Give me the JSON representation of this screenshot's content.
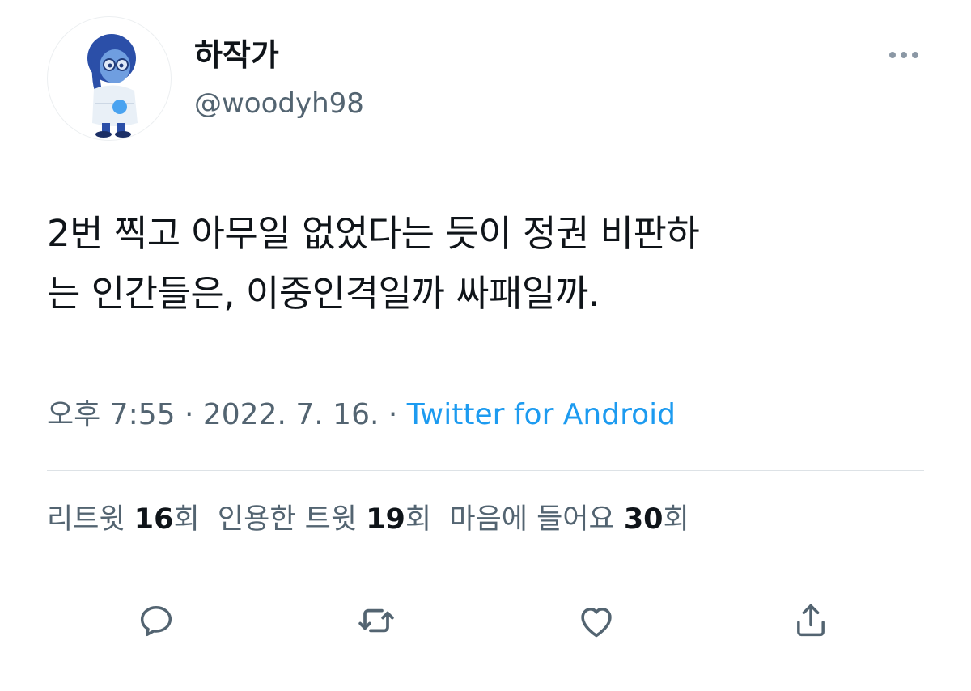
{
  "tweet": {
    "author": {
      "display_name": "하작가",
      "handle": "@woodyh98"
    },
    "text_lines": [
      "2번 찍고 아무일 없었다는 듯이 정권 비판하",
      "는 인간들은, 이중인격일까 싸패일까."
    ],
    "meta": {
      "time": "오후 7:55",
      "separator": " · ",
      "date": "2022. 7. 16.",
      "source": "Twitter for Android"
    },
    "stats": {
      "retweets": {
        "label": "리트윗 ",
        "count": "16",
        "suffix": "회"
      },
      "quotes": {
        "label": "인용한 트윗 ",
        "count": "19",
        "suffix": "회"
      },
      "likes": {
        "label": "마음에 들어요 ",
        "count": "30",
        "suffix": "회"
      }
    },
    "actions": [
      "reply-icon",
      "retweet-icon",
      "like-icon",
      "share-icon"
    ]
  },
  "colors": {
    "text": "#0f1419",
    "muted": "#536471",
    "link": "#1d9bf0",
    "divider": "#dde2e6",
    "avatar_hair": "#2b4fa8",
    "avatar_skin": "#6f9ee0",
    "avatar_sweater": "#e9f0f7"
  }
}
